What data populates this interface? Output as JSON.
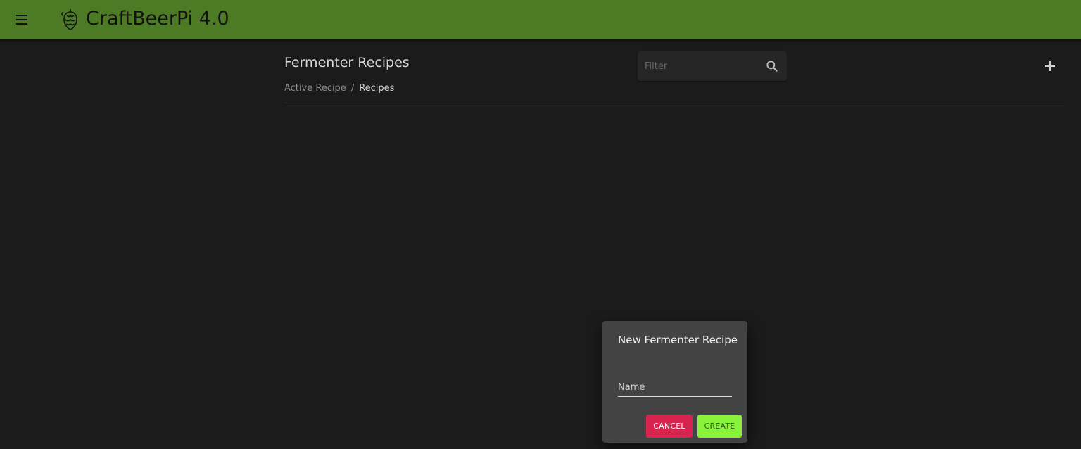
{
  "header": {
    "app_title": "CraftBeerPi 4.0",
    "background_color": "#4d7a25",
    "menu_icon": "menu-icon",
    "logo_icon": "hop-icon"
  },
  "main": {
    "page_title": "Fermenter Recipes",
    "breadcrumb": [
      {
        "label": "Active Recipe"
      },
      {
        "label": "/"
      },
      {
        "label": "Recipes"
      }
    ],
    "filter": {
      "placeholder": "Filter",
      "value": "",
      "icon": "search-icon"
    },
    "add_icon": "plus-icon"
  },
  "dialog": {
    "title": "New Fermenter Recipe",
    "name_field": {
      "placeholder": "Name",
      "value": ""
    },
    "cancel_label": "CANCEL",
    "create_label": "CREATE",
    "cancel_color": "#d6244f",
    "create_color": "#89f23a"
  }
}
